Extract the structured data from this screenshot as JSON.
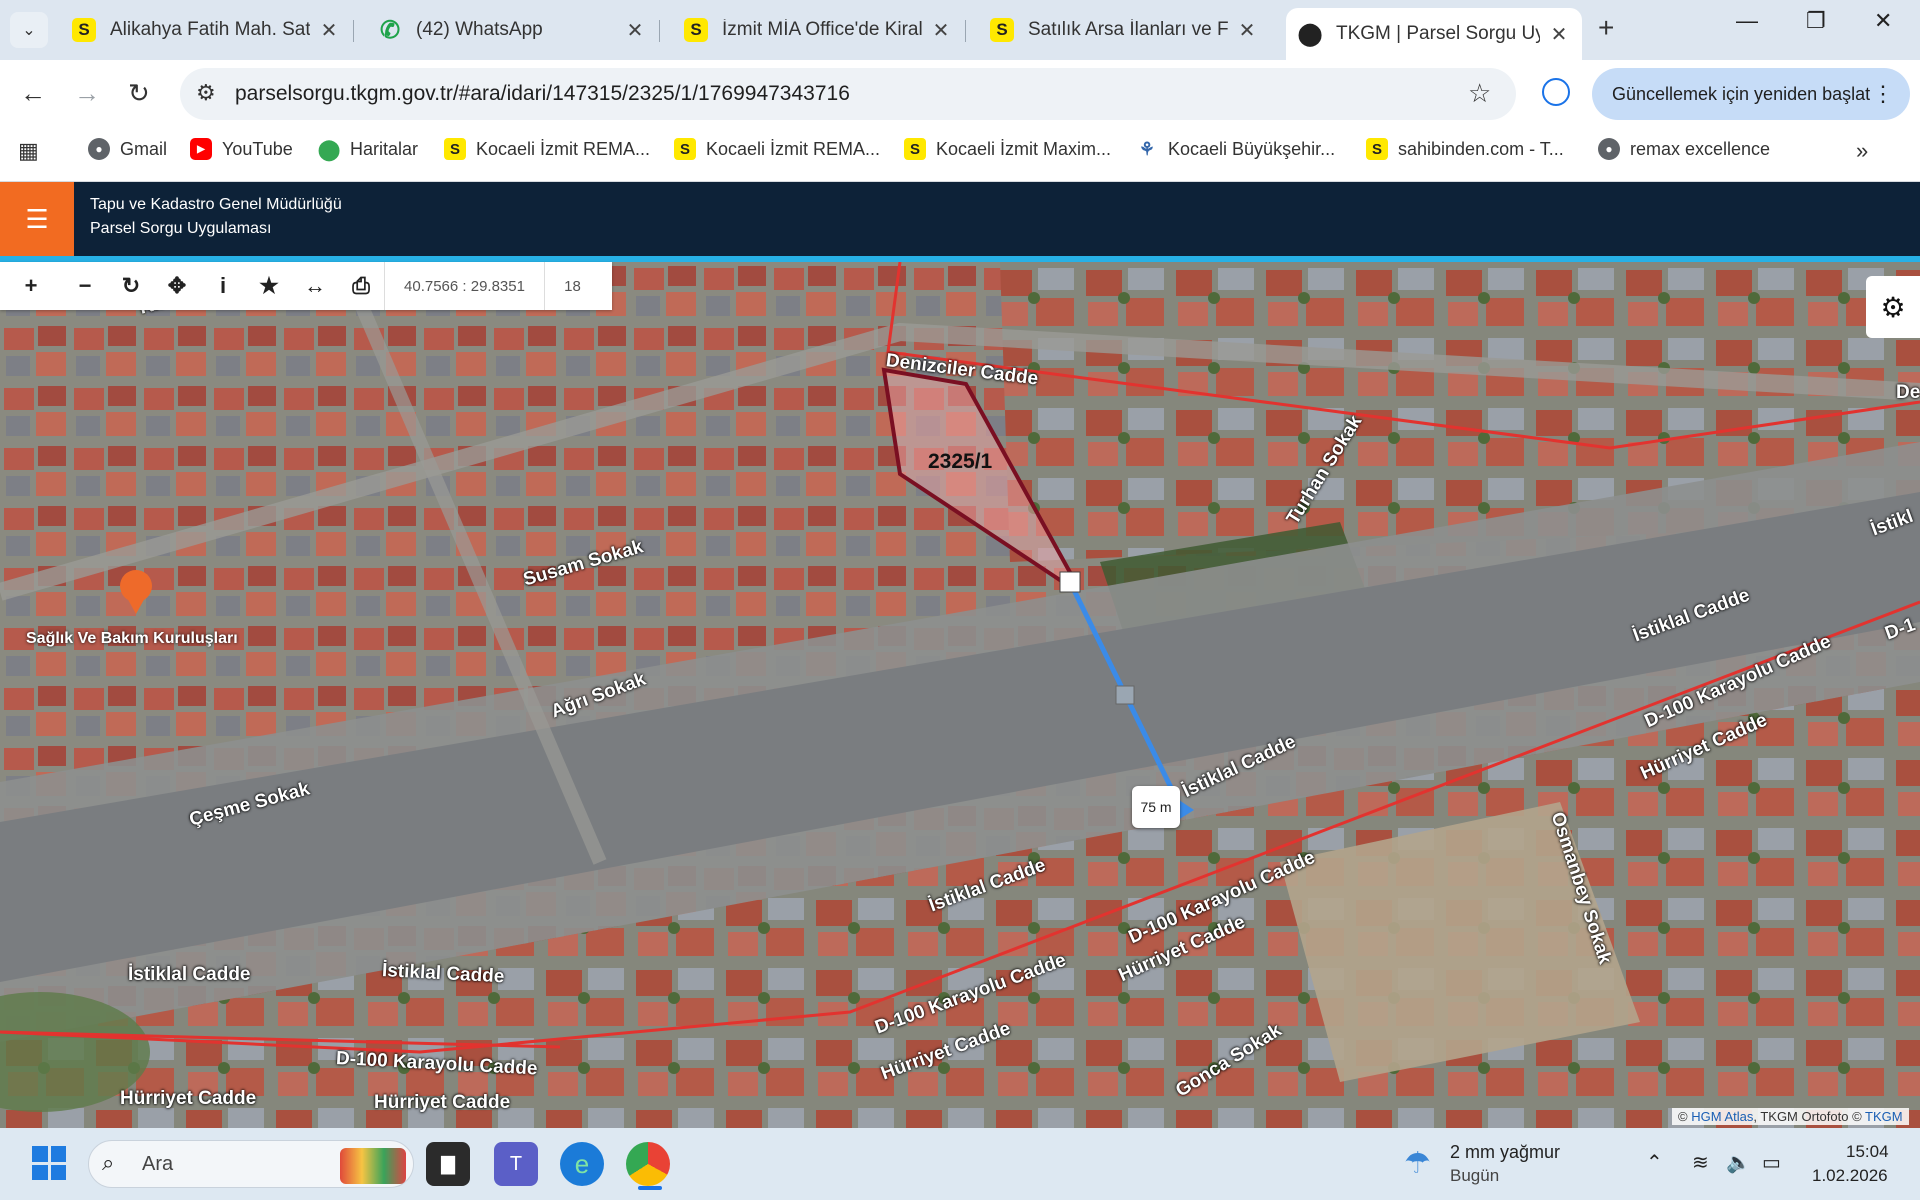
{
  "browser": {
    "tabs": [
      {
        "title": "Alikahya Fatih Mah. Satılık",
        "favicon": "sahibinden-s-icon"
      },
      {
        "title": "(42) WhatsApp",
        "favicon": "whatsapp-icon"
      },
      {
        "title": "İzmit MİA Office'de Kiralık",
        "favicon": "sahibinden-s-icon"
      },
      {
        "title": "Satılık Arsa İlanları ve Fiyat",
        "favicon": "sahibinden-s-icon"
      },
      {
        "title": "TKGM | Parsel Sorgu Uyg",
        "favicon": "map-pin-icon",
        "active": true
      }
    ],
    "url": "parselsorgu.tkgm.gov.tr/#ara/idari/147315/2325/1/1769947343716",
    "update_button": "Güncellemek için yeniden başlat",
    "bookmarks": [
      {
        "label": "Gmail",
        "icon": "globe-icon"
      },
      {
        "label": "YouTube",
        "icon": "youtube-icon"
      },
      {
        "label": "Haritalar",
        "icon": "maps-icon"
      },
      {
        "label": "Kocaeli İzmit REMA...",
        "icon": "sahibinden-s-icon"
      },
      {
        "label": "Kocaeli İzmit REMA...",
        "icon": "sahibinden-s-icon"
      },
      {
        "label": "Kocaeli İzmit Maxim...",
        "icon": "sahibinden-s-icon"
      },
      {
        "label": "Kocaeli Büyükşehir...",
        "icon": "kocaeli-icon"
      },
      {
        "label": "sahibinden.com - T...",
        "icon": "sahibinden-s-icon"
      },
      {
        "label": "remax excellence",
        "icon": "globe-icon"
      }
    ]
  },
  "app": {
    "title_line1": "Tapu ve Kadastro Genel Müdürlüğü",
    "title_line2": "Parsel Sorgu Uygulaması",
    "header_color": "#0d2238",
    "accent_color": "#f26b21"
  },
  "map": {
    "coordinates": "40.7566 : 29.8351",
    "zoom_level": "18",
    "parcel_label": "2325/1",
    "measure_label": "75 m",
    "poi_label": "Sağlık Ve Bakım Kuruluşları",
    "attribution_prefix": "©",
    "attribution_link1": "HGM Atlas",
    "attribution_mid": ", TKGM Ortofoto ©",
    "attribution_link2": "TKGM",
    "streets": [
      "Kırım Sokak",
      "Denizciler Cadde",
      "Susam Sokak",
      "Ağrı Sokak",
      "Çeşme Sokak",
      "Turhan Sokak",
      "İstiklal Cadde",
      "İstiklal Cadde",
      "İstiklal Cadde",
      "İstiklal Cadde",
      "İstiklal Cadde",
      "D-100 Karayolu Cadde",
      "D-100 Karayolu Cadde",
      "D-100 Karayolu Cadde",
      "D-100 Karayolu Cadde",
      "Hürriyet Cadde",
      "Hürriyet Cadde",
      "Hürriyet Cadde",
      "Hürriyet Cadde",
      "Hürriyet Cadde",
      "Osmanbey Sokak",
      "Gonca Sokak",
      "İstikl",
      "D-1",
      "De"
    ]
  },
  "taskbar": {
    "search_placeholder": "Ara",
    "weather_line1": "2 mm yağmur",
    "weather_line2": "Bugün",
    "time": "15:04",
    "date": "1.02.2026"
  }
}
